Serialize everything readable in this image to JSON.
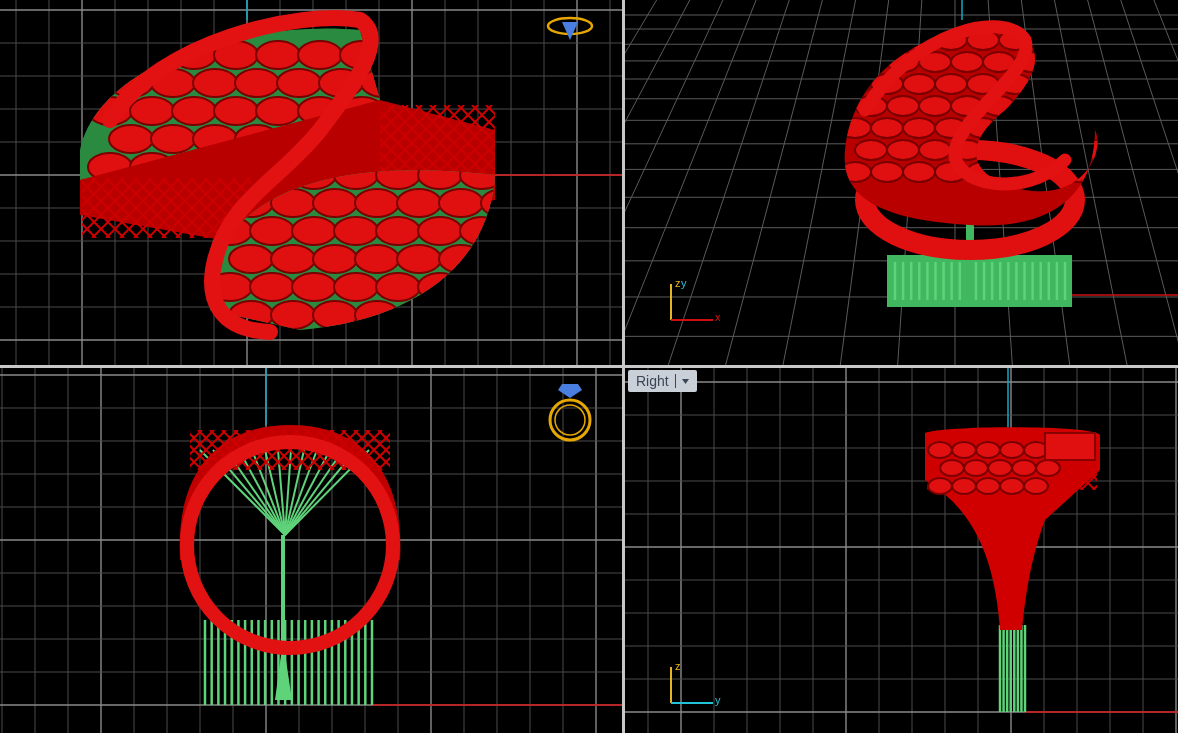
{
  "viewports": [
    {
      "kind": "top"
    },
    {
      "kind": "perspective",
      "axis_labels": [
        "z",
        "y",
        "x"
      ]
    },
    {
      "kind": "front"
    },
    {
      "kind": "right",
      "label": "Right",
      "axis_labels": [
        "z",
        "y"
      ]
    }
  ]
}
